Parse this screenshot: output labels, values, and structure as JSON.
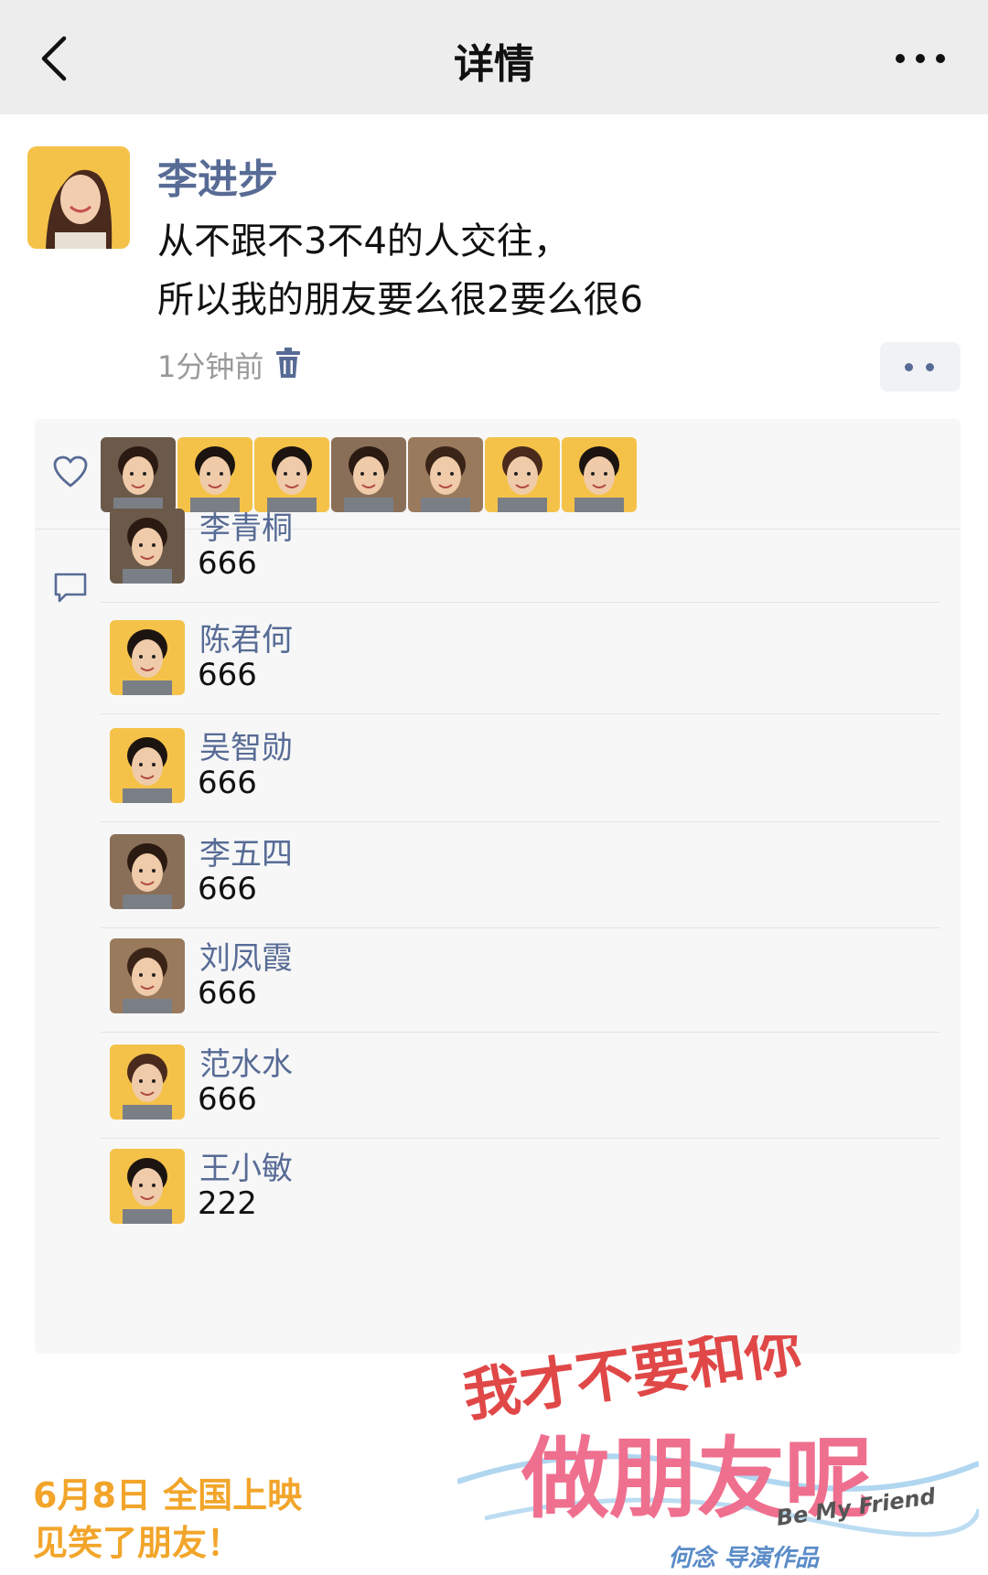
{
  "header": {
    "title": "详情"
  },
  "post": {
    "author": "李进步",
    "lines": [
      "从不跟不3不4的人交往，",
      "所以我的朋友要么很2要么很6"
    ],
    "time": "1分钟前"
  },
  "likes": [
    {
      "name": "李青桐",
      "bg": "#6b5a4a"
    },
    {
      "name": "陈君何",
      "bg": "#f5c249"
    },
    {
      "name": "吴智勋",
      "bg": "#f5c249"
    },
    {
      "name": "李五四",
      "bg": "#8a6f58"
    },
    {
      "name": "刘凤霞",
      "bg": "#9a7a5c"
    },
    {
      "name": "范水水",
      "bg": "#f5c249"
    },
    {
      "name": "王小敏",
      "bg": "#f5c249"
    }
  ],
  "comments": [
    {
      "name": "李青桐",
      "text": "666",
      "bg": "#6b5a4a"
    },
    {
      "name": "陈君何",
      "text": "666",
      "bg": "#f5c249"
    },
    {
      "name": "吴智勋",
      "text": "666",
      "bg": "#f5c249"
    },
    {
      "name": "李五四",
      "text": "666",
      "bg": "#8a6f58"
    },
    {
      "name": "刘凤霞",
      "text": "666",
      "bg": "#9a7a5c"
    },
    {
      "name": "范水水",
      "text": "666",
      "bg": "#f5c249"
    },
    {
      "name": "王小敏",
      "text": "222",
      "bg": "#f5c249"
    }
  ],
  "poster": {
    "release": "6月8日 全国上映",
    "tagline": "见笑了朋友！",
    "logo_line1": "我才不要和你",
    "logo_line2": "做朋友呢",
    "logo_english": "Be My Friend",
    "director": "何念 导演作品"
  },
  "colors": {
    "link": "#576b95",
    "header_bg": "#ededed",
    "panel_bg": "#f7f7f7",
    "poster_orange": "#f2a52a"
  }
}
